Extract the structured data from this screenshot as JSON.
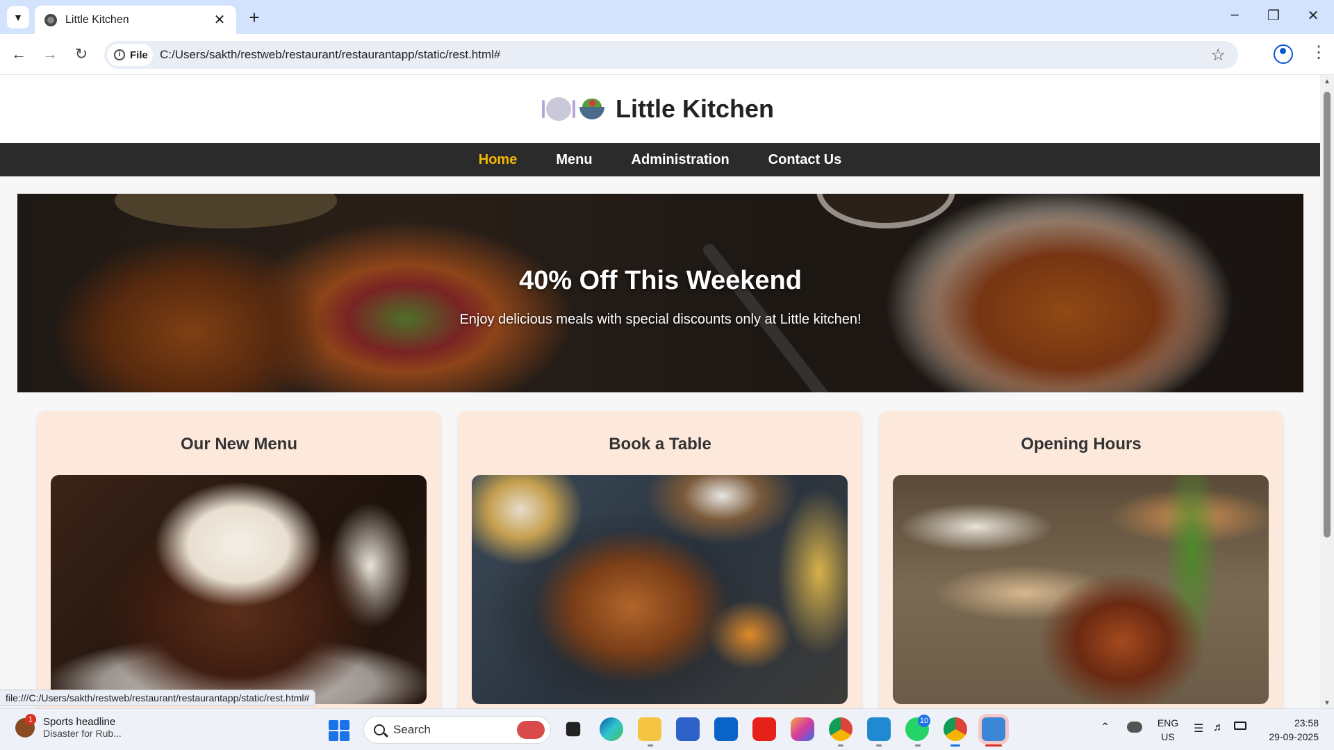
{
  "browser": {
    "tab_title": "Little Kitchen",
    "site_chip": "File",
    "url": "C:/Users/sakth/restweb/restaurant/restaurantapp/static/rest.html#",
    "status_url": "file:///C:/Users/sakth/restweb/restaurant/restaurantapp/static/rest.html#",
    "icons": {
      "tab_list": "chevron-down-icon",
      "favicon": "globe-icon",
      "tab_close": "close-icon",
      "new_tab": "plus-icon",
      "back": "arrow-left-icon",
      "forward": "arrow-right-icon",
      "reload": "reload-icon",
      "site_info": "info-icon",
      "bookmark": "star-icon",
      "profile": "profile-icon",
      "menu": "kebab-icon",
      "minimize": "minimize-icon",
      "restore": "restore-icon",
      "close_window": "close-icon"
    }
  },
  "site": {
    "title": "Little Kitchen",
    "nav": [
      {
        "label": "Home",
        "active": true
      },
      {
        "label": "Menu",
        "active": false
      },
      {
        "label": "Administration",
        "active": false
      },
      {
        "label": "Contact Us",
        "active": false
      }
    ],
    "hero": {
      "title": "40% Off This Weekend",
      "subtitle": "Enjoy delicious meals with special discounts only at Little kitchen!"
    },
    "cards": [
      {
        "title": "Our New Menu",
        "image": "chocolate-dessert-photo"
      },
      {
        "title": "Book a Table",
        "image": "grilled-chicken-platter-photo"
      },
      {
        "title": "Opening Hours",
        "image": "chicken-tikka-photo"
      }
    ],
    "colors": {
      "nav_bg": "#2b2b2b",
      "nav_active": "#f5b800",
      "card_bg": "#fde9dc"
    }
  },
  "taskbar": {
    "news": {
      "badge": "1",
      "headline": "Sports headline",
      "subtext": "Disaster for Rub..."
    },
    "search_label": "Search",
    "apps": [
      {
        "name": "task-view-icon"
      },
      {
        "name": "edge-icon"
      },
      {
        "name": "file-explorer-icon"
      },
      {
        "name": "microsoft-store-icon"
      },
      {
        "name": "outlook-icon"
      },
      {
        "name": "youtube-icon"
      },
      {
        "name": "copilot-icon"
      },
      {
        "name": "chrome-icon"
      },
      {
        "name": "vscode-icon"
      },
      {
        "name": "whatsapp-icon",
        "badge": "10"
      },
      {
        "name": "chrome-icon"
      },
      {
        "name": "photos-icon"
      }
    ],
    "language": {
      "line1": "ENG",
      "line2": "US"
    },
    "time": "23:58",
    "date": "29-09-2025"
  }
}
